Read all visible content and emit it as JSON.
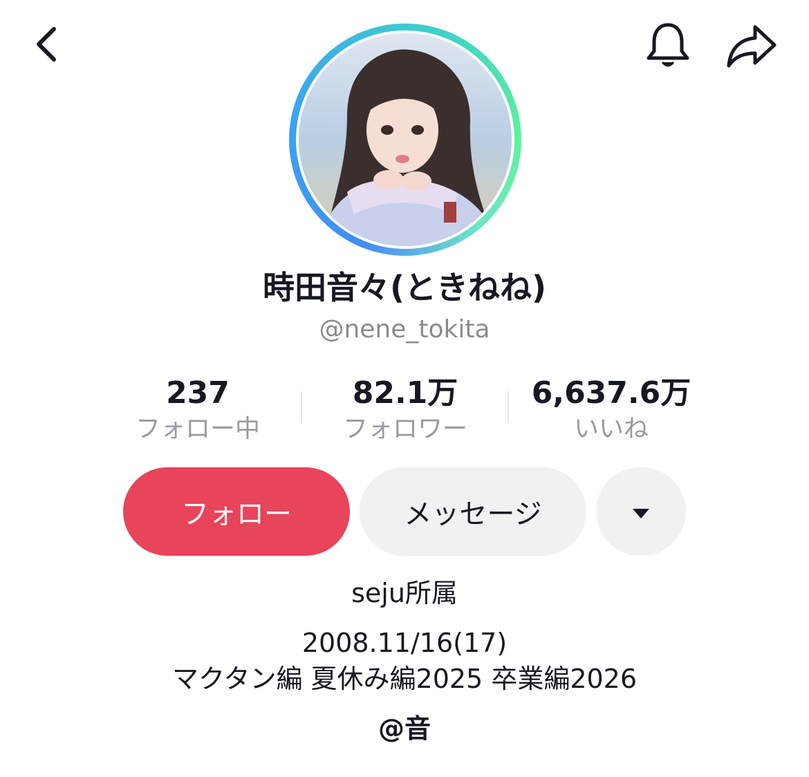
{
  "header": {
    "back_icon": "chevron-left-icon",
    "bell_icon": "bell-icon",
    "share_icon": "share-arrow-icon"
  },
  "profile": {
    "avatar_ring_colors": [
      "#3f8ef5",
      "#5ff0a0"
    ],
    "display_name": "時田音々(ときねね)",
    "username": "@nene_tokita"
  },
  "stats": [
    {
      "value": "237",
      "label": "フォロー中"
    },
    {
      "value": "82.1万",
      "label": "フォロワー"
    },
    {
      "value": "6,637.6万",
      "label": "いいね"
    }
  ],
  "actions": {
    "follow_label": "フォロー",
    "message_label": "メッセージ",
    "more_icon": "caret-down-icon",
    "follow_color": "#e8445a"
  },
  "bio": {
    "affiliation": "seju所属",
    "birth": "2008.11/16(17)",
    "series": "マクタン編 夏休み編2025 卒業編2026",
    "link": "@音"
  }
}
